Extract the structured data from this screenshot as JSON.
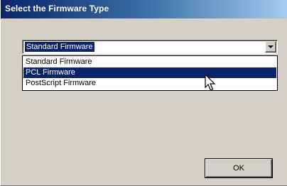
{
  "window": {
    "title": "Select the Firmware Type"
  },
  "firmware_select": {
    "selected_value": "Standard Firmware",
    "options": [
      {
        "label": "Standard Firmware",
        "highlighted": false
      },
      {
        "label": "PCL Firmware",
        "highlighted": true
      },
      {
        "label": "PostScript Firmware",
        "highlighted": false
      }
    ]
  },
  "buttons": {
    "ok_label": "OK"
  },
  "colors": {
    "title_bar_start": "#0a246a",
    "title_bar_end": "#a6caf0",
    "selection": "#0a246a",
    "face": "#d4d0c8"
  },
  "icons": {
    "cursor": "mouse-pointer-icon",
    "dropdown": "chevron-down-icon"
  }
}
